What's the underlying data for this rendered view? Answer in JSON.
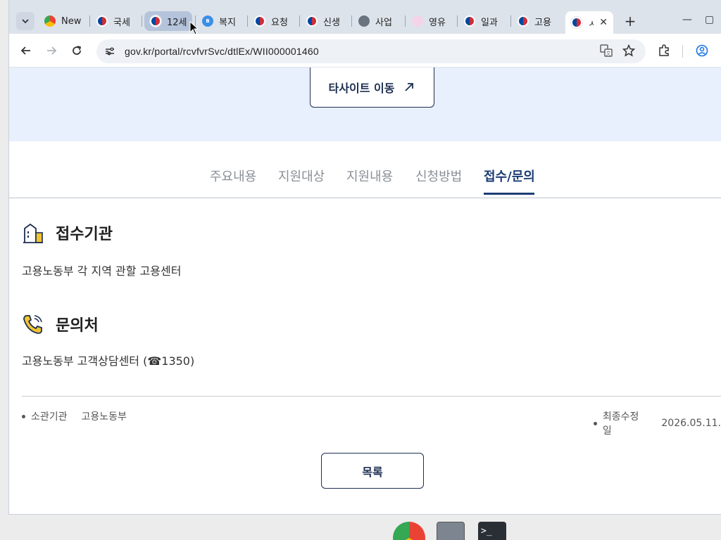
{
  "browser": {
    "tabs": [
      {
        "title": "New",
        "favicon": "chrome-icon"
      },
      {
        "title": "국세",
        "favicon": "gov-icon"
      },
      {
        "title": "12세",
        "favicon": "gov-icon",
        "state": "hovered"
      },
      {
        "title": "복지",
        "favicon": "bokji-icon"
      },
      {
        "title": "요청",
        "favicon": "gov-icon"
      },
      {
        "title": "신생",
        "favicon": "gov-icon"
      },
      {
        "title": "사업",
        "favicon": "globe-icon"
      },
      {
        "title": "영유",
        "favicon": "misc-icon"
      },
      {
        "title": "일과",
        "favicon": "gov-icon"
      },
      {
        "title": "고용",
        "favicon": "gov-icon"
      },
      {
        "title": "ㅅ",
        "favicon": "gov-icon",
        "state": "active"
      }
    ],
    "url": "gov.kr/portal/rcvfvrSvc/dtlEx/WII000001460"
  },
  "page": {
    "external_button": "타사이트 이동",
    "nav_tabs": [
      "주요내용",
      "지원대상",
      "지원내용",
      "신청방법",
      "접수/문의"
    ],
    "active_tab": "접수/문의",
    "sections": [
      {
        "title": "접수기관",
        "body": "고용노동부 각 지역 관할 고용센터",
        "icon": "building-icon"
      },
      {
        "title": "문의처",
        "body": "고용노동부 고객상담센터 (☎1350)",
        "icon": "phone-icon"
      }
    ],
    "meta": {
      "agency_label": "소관기관",
      "agency_value": "고용노동부",
      "updated_label": "최종수정일",
      "updated_value": "2026.05.11."
    },
    "list_button": "목록"
  },
  "colors": {
    "accent": "#1d3d75",
    "banner_bg": "#e8effd"
  }
}
